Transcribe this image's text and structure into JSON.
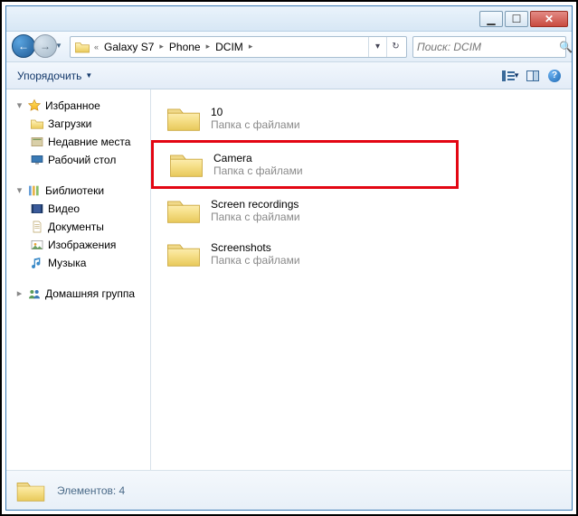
{
  "window_controls": {
    "min": "▁",
    "max": "☐",
    "close": "✕"
  },
  "breadcrumb": {
    "prefix": "«",
    "parts": [
      "Galaxy S7",
      "Phone",
      "DCIM"
    ],
    "sep": "▸"
  },
  "search": {
    "placeholder": "Поиск: DCIM"
  },
  "toolbar": {
    "organize": "Упорядочить"
  },
  "sidebar": {
    "favorites": {
      "label": "Избранное",
      "items": [
        "Загрузки",
        "Недавние места",
        "Рабочий стол"
      ]
    },
    "libraries": {
      "label": "Библиотеки",
      "items": [
        "Видео",
        "Документы",
        "Изображения",
        "Музыка"
      ]
    },
    "homegroup": {
      "label": "Домашняя группа"
    }
  },
  "content": {
    "items": [
      {
        "name": "10",
        "subtitle": "Папка с файлами",
        "highlight": false
      },
      {
        "name": "Camera",
        "subtitle": "Папка с файлами",
        "highlight": true
      },
      {
        "name": "Screen recordings",
        "subtitle": "Папка с файлами",
        "highlight": false
      },
      {
        "name": "Screenshots",
        "subtitle": "Папка с файлами",
        "highlight": false
      }
    ]
  },
  "status": {
    "text": "Элементов: 4"
  }
}
